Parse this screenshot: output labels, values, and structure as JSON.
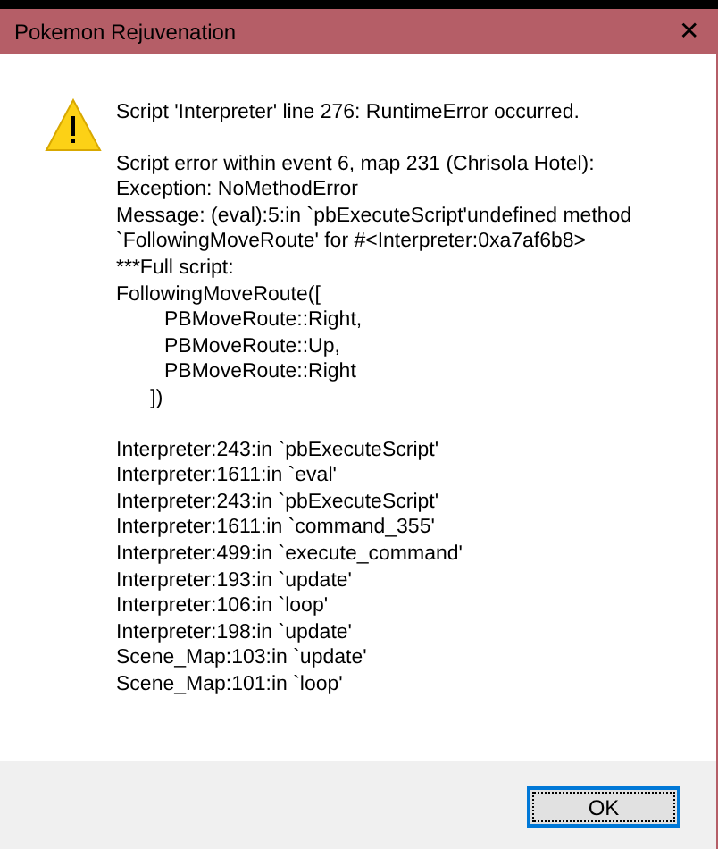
{
  "window": {
    "title": "Pokemon Rejuvenation",
    "close": "✕"
  },
  "message": {
    "heading": "Script 'Interpreter' line 276: RuntimeError occurred.",
    "paragraphs": [
      [
        "Script error within event 6, map 231 (Chrisola Hotel):",
        "Exception: NoMethodError",
        "Message: (eval):5:in `pbExecuteScript'undefined method",
        "`FollowingMoveRoute' for #<Interpreter:0xa7af6b8>",
        "***Full script:",
        "FollowingMoveRoute([",
        "\tPBMoveRoute::Right,",
        "\tPBMoveRoute::Up,",
        "\tPBMoveRoute::Right",
        "      ])"
      ],
      [
        "Interpreter:243:in `pbExecuteScript'",
        "Interpreter:1611:in `eval'",
        "Interpreter:243:in `pbExecuteScript'",
        "Interpreter:1611:in `command_355'",
        "Interpreter:499:in `execute_command'",
        "Interpreter:193:in `update'",
        "Interpreter:106:in `loop'",
        "Interpreter:198:in `update'",
        "Scene_Map:103:in `update'",
        "Scene_Map:101:in `loop'"
      ]
    ]
  },
  "buttons": [
    {
      "label": "OK",
      "focused": true
    }
  ]
}
